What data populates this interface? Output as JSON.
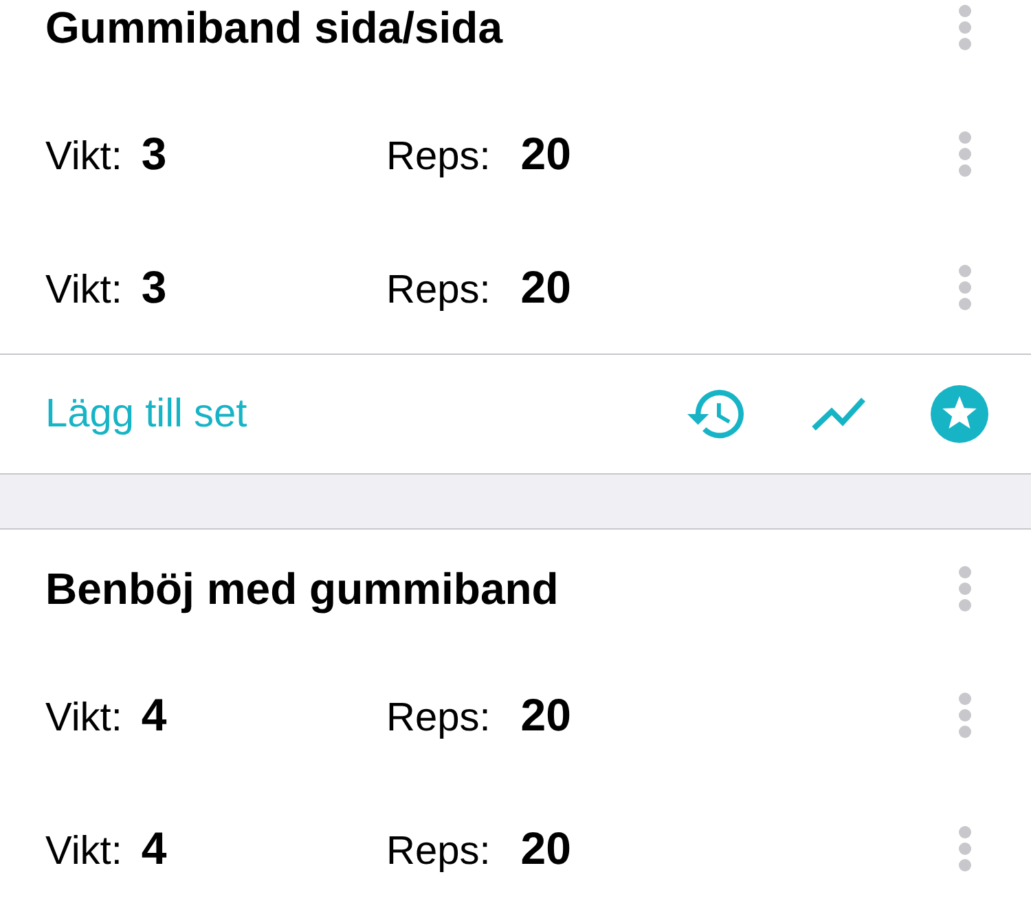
{
  "exercises": [
    {
      "name": "Gummiband sida/sida",
      "sets": [
        {
          "weight_label": "Vikt:",
          "weight": "3",
          "reps_label": "Reps:",
          "reps": "20"
        },
        {
          "weight_label": "Vikt:",
          "weight": "3",
          "reps_label": "Reps:",
          "reps": "20"
        }
      ],
      "add_set": "Lägg till set"
    },
    {
      "name": "Benböj med gummiband",
      "sets": [
        {
          "weight_label": "Vikt:",
          "weight": "4",
          "reps_label": "Reps:",
          "reps": "20"
        },
        {
          "weight_label": "Vikt:",
          "weight": "4",
          "reps_label": "Reps:",
          "reps": "20"
        }
      ]
    }
  ]
}
